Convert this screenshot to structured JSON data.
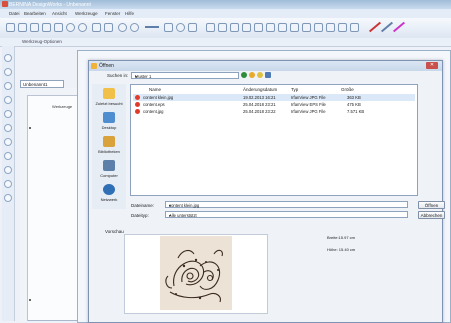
{
  "app": {
    "title": "BERNINA DesignWorks - Unbenannt",
    "menu": [
      "Datei",
      "Bearbeiten",
      "Ansicht",
      "Werkzeuge",
      "Fenster",
      "Hilfe"
    ],
    "tool_options_label": "Werkzeug-Optionen",
    "document_tab": "Unbenannt1",
    "workspace_label": "Werkzeuge"
  },
  "dialog": {
    "title": "Öffnen",
    "look_in_label": "Suchen in:",
    "look_in_value": "Muster 1",
    "places": [
      {
        "label": "Zuletzt besucht",
        "icon": "recent-places-icon"
      },
      {
        "label": "Desktop",
        "icon": "desktop-icon"
      },
      {
        "label": "Bibliotheken",
        "icon": "libraries-icon"
      },
      {
        "label": "Computer",
        "icon": "computer-icon"
      },
      {
        "label": "Netzwerk",
        "icon": "network-icon"
      }
    ],
    "columns": [
      "Name",
      "Änderungsdatum",
      "Typ",
      "Größe"
    ],
    "files": [
      {
        "name": "content klein.jpg",
        "date": "19.02.2013 16:21",
        "type": "IrfanView JPG File",
        "size": "363 KB"
      },
      {
        "name": "content.eps",
        "date": "25.04.2018 23:21",
        "type": "IrfanView EPS File",
        "size": "475 KB"
      },
      {
        "name": "content.jpg",
        "date": "25.04.2018 23:22",
        "type": "IrfanView JPG File",
        "size": "7.571 KB"
      }
    ],
    "filename_label": "Dateiname:",
    "filename_value": "content klein.jpg",
    "filetype_label": "Dateityp:",
    "filetype_value": "Alle unterstützt",
    "open_button": "Öffnen",
    "cancel_button": "Abbrechen",
    "preview_label": "Vorschau",
    "preview_width": "Breite:15.97 cm",
    "preview_height": "Höhe: 15.40 cm"
  },
  "colors": {
    "accent": "#4f7ab3",
    "file_icon": "#e33b2b"
  }
}
